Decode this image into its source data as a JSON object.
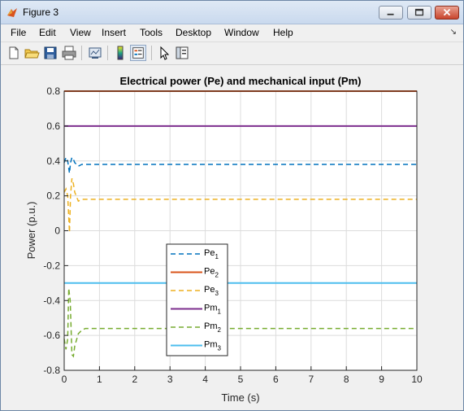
{
  "window": {
    "title": "Figure 3"
  },
  "menubar": {
    "items": [
      "File",
      "Edit",
      "View",
      "Insert",
      "Tools",
      "Desktop",
      "Window",
      "Help"
    ],
    "dock_glyph": "↘"
  },
  "toolbar": {
    "buttons": [
      {
        "name": "new-figure-icon"
      },
      {
        "name": "open-file-icon"
      },
      {
        "name": "save-icon"
      },
      {
        "name": "print-icon"
      },
      {
        "name": "link-plot-icon"
      },
      {
        "name": "insert-colorbar-icon"
      },
      {
        "name": "insert-legend-icon",
        "pressed": true
      },
      {
        "name": "edit-plot-arrow-icon"
      },
      {
        "name": "show-plot-tools-icon"
      }
    ]
  },
  "chart_data": {
    "type": "line",
    "title": "Electrical power (Pe) and mechanical input (Pm)",
    "xlabel": "Time (s)",
    "ylabel": "Power (p.u.)",
    "xlim": [
      0,
      10
    ],
    "ylim": [
      -0.8,
      0.8
    ],
    "xticks": [
      "0",
      "1",
      "2",
      "3",
      "4",
      "5",
      "6",
      "7",
      "8",
      "9",
      "10"
    ],
    "yticks": [
      "0.8",
      "0.6",
      "0.4",
      "0.2",
      "0",
      "-0.2",
      "-0.4",
      "-0.6",
      "-0.8"
    ],
    "grid": true,
    "legend_position": "lower-center",
    "series": [
      {
        "name": "Pe",
        "sub": "1",
        "color": "#0072BD",
        "style": "dashed",
        "x": [
          0,
          0.05,
          0.1,
          0.15,
          0.18,
          0.22,
          0.26,
          0.3,
          0.4,
          0.5,
          0.7,
          1,
          10
        ],
        "y": [
          0.39,
          0.42,
          0.4,
          0.33,
          0.39,
          0.42,
          0.41,
          0.39,
          0.37,
          0.38,
          0.38,
          0.38,
          0.38
        ]
      },
      {
        "name": "Pe",
        "sub": "2",
        "color": "#D95319",
        "style": "solid",
        "x": [
          0,
          10
        ],
        "y": [
          0.8,
          0.8
        ]
      },
      {
        "name": "Pe",
        "sub": "3",
        "color": "#EDB120",
        "style": "dashed",
        "x": [
          0,
          0.05,
          0.1,
          0.15,
          0.18,
          0.22,
          0.26,
          0.3,
          0.4,
          0.5,
          0.7,
          1,
          10
        ],
        "y": [
          0.22,
          0.24,
          0.2,
          -0.01,
          0.2,
          0.3,
          0.27,
          0.22,
          0.17,
          0.18,
          0.18,
          0.18,
          0.18
        ]
      },
      {
        "name": "Pm",
        "sub": "1",
        "color": "#7E2F8E",
        "style": "solid",
        "x": [
          0,
          10
        ],
        "y": [
          0.6,
          0.6
        ]
      },
      {
        "name": "Pm",
        "sub": "2",
        "color": "#77AC30",
        "style": "dashed",
        "x": [
          0,
          0.05,
          0.1,
          0.13,
          0.17,
          0.22,
          0.26,
          0.3,
          0.4,
          0.5,
          0.6,
          0.8,
          1,
          10
        ],
        "y": [
          -0.62,
          -0.68,
          -0.62,
          -0.33,
          -0.4,
          -0.71,
          -0.72,
          -0.66,
          -0.59,
          -0.57,
          -0.56,
          -0.56,
          -0.56,
          -0.56
        ]
      },
      {
        "name": "Pm",
        "sub": "3",
        "color": "#4DBEEE",
        "style": "solid",
        "x": [
          0,
          10
        ],
        "y": [
          -0.3,
          -0.3
        ]
      }
    ]
  }
}
